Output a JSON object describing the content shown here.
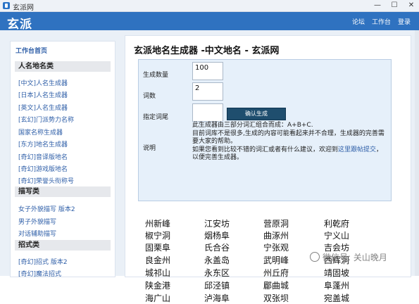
{
  "window": {
    "title": "玄派网",
    "btn_min": "—",
    "btn_max": "☐",
    "btn_close": "✕"
  },
  "header": {
    "logo": "玄派",
    "links": [
      "论坛",
      "工作台",
      "登录"
    ]
  },
  "sidebar": {
    "home": "工作台首页",
    "sections": [
      {
        "title": "人名地名类",
        "items": [
          "[中文]人名生成器",
          "[日本]人名生成器",
          "[英文]人名生成器",
          "[玄幻]门派势力名称",
          "国家名称生成器",
          "[东方]地名生成器",
          "[奇幻]音译版地名",
          "[奇幻]游戏版地名",
          "[奇幻]荣誉头衔称号"
        ]
      },
      {
        "title": "描写类",
        "items": [
          "女子外貌描写 版本2",
          "男子外貌描写",
          "对话辅助描写"
        ]
      },
      {
        "title": "招式类",
        "items": [
          "[奇幻]招式 版本2",
          "[奇幻]魔法招式"
        ]
      }
    ]
  },
  "main": {
    "title": "玄派地名生成器 -中文地名 - 玄派网",
    "form": {
      "count_label": "生成数量",
      "count_value": "100",
      "words_label": "词数",
      "words_value": "2",
      "fixed_label": "指定词尾",
      "fixed_value": "",
      "button_label": "确认生成",
      "desc_label": "说明",
      "desc_line1": "此生成器由三部分词汇组合而成：A+B+C.",
      "desc_line2": "目前词库不是很多,生成的内容可能看起来并不合理，生成器的完善需要大家的帮助。",
      "desc_line3_pre": "如果您看到比较不错的词汇或者有什么建议，欢迎到",
      "desc_line3_link": "这里跟帖提交",
      "desc_line3_post": "，以便完善生成器。"
    },
    "names": [
      [
        "州新峰",
        "江安坊",
        "营原洞",
        "利乾府"
      ],
      [
        "椒宁洞",
        "烟杨阜",
        "曲涿州",
        "宁义山"
      ],
      [
        "固栗阜",
        "氏合谷",
        "宁张观",
        "吉会坊"
      ],
      [
        "良金州",
        "永盖岛",
        "武明峰",
        "西辉洞"
      ],
      [
        "城祁山",
        "永东区",
        "州丘府",
        "靖固坡"
      ],
      [
        "陕金港",
        "邱泾镇",
        "郿曲城",
        "阜蓬州"
      ],
      [
        "海广山",
        "泸海阜",
        "双张坝",
        "宛盖城"
      ]
    ]
  },
  "watermark": "微信号: 关山晚月"
}
